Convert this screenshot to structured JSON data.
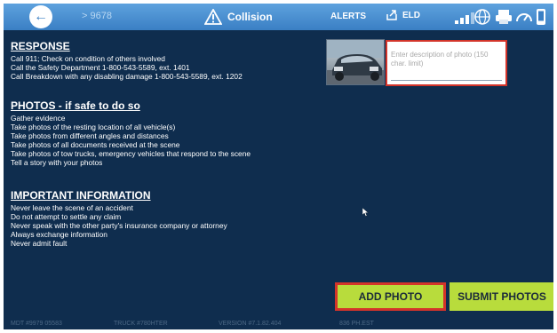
{
  "topbar": {
    "back_icon": "arrow-left-icon",
    "breadcrumb": "> 9678",
    "title": "Collision",
    "title_icon": "warning-triangle-icon",
    "alerts_label": "ALERTS",
    "eld_label": "ELD",
    "eld_icon": "export-icon",
    "icons": [
      "signal-icon",
      "globe-icon",
      "printer-icon",
      "gauge-icon",
      "phone-icon"
    ]
  },
  "sections": {
    "response": {
      "title": "RESPONSE",
      "lines": [
        "Call 911; Check on condition of others involved",
        "Call the Safety Department 1-800-543-5589, ext. 1401",
        "Call Breakdown with any disabling damage 1-800-543-5589, ext. 1202"
      ]
    },
    "photos": {
      "title": "PHOTOS - if safe to do so",
      "lines": [
        "Gather evidence",
        "Take photos of the resting location of all vehicle(s)",
        "Take photos from different angles and distances",
        "Take photos of all documents received at the scene",
        "Take photos of tow trucks, emergency vehicles that respond to the scene",
        "Tell a story with your photos"
      ]
    },
    "important": {
      "title": "IMPORTANT INFORMATION",
      "lines": [
        "Never leave the scene of an accident",
        "Do not attempt to settle any claim",
        "Never speak with the other party's insurance company or attorney",
        "Always exchange information",
        "Never admit fault"
      ]
    }
  },
  "photo": {
    "description_placeholder": "Enter description of photo (150 char. limit)",
    "description_value": ""
  },
  "buttons": {
    "add_photo": "ADD PHOTO",
    "submit_photos": "SUBMIT PHOTOS"
  },
  "statusbar": {
    "items": [
      "MDT #9979 05583",
      "TRUCK #780HTER",
      "VERSION #7.1.82.404",
      "836 PH.EST"
    ]
  },
  "colors": {
    "background": "#0f2d4e",
    "topbar": "#4a8fd2",
    "button": "#b8dc3c",
    "highlight": "#d3342a"
  }
}
